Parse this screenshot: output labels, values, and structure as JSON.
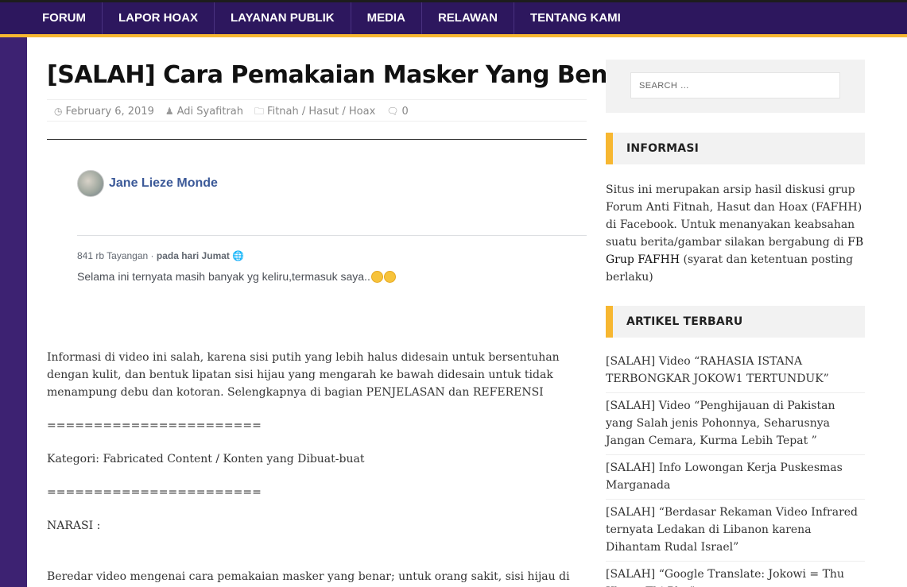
{
  "nav": [
    {
      "label": "FORUM"
    },
    {
      "label": "LAPOR HOAX"
    },
    {
      "label": "LAYANAN PUBLIK"
    },
    {
      "label": "MEDIA"
    },
    {
      "label": "RELAWAN"
    },
    {
      "label": "TENTANG KAMI"
    }
  ],
  "post": {
    "title": "[SALAH] Cara Pemakaian Masker Yang Benar",
    "date": "February 6, 2019",
    "author": "Adi Syafitrah",
    "category": "Fitnah / Hasut / Hoax",
    "comments": "0"
  },
  "embed": {
    "name": "Jane Lieze Monde",
    "views": "841 rb Tayangan",
    "separator": "·",
    "when": "pada hari Jumat",
    "caption": "Selama ini ternyata masih banyak yg keliru,termasuk saya.."
  },
  "body": {
    "para1": "Informasi di video ini salah, karena sisi putih yang lebih halus didesain untuk bersentuhan dengan kulit, dan bentuk lipatan sisi hijau yang mengarah ke bawah didesain untuk tidak menampung debu dan kotoran. Selengkapnya di bagian PENJELASAN dan REFERENSI",
    "rule1": "=======================",
    "kategori": "Kategori: Fabricated Content / Konten yang Dibuat-buat",
    "rule2": "=======================",
    "narasi": "NARASI :",
    "para2": "Beredar video mengenai cara pemakaian masker yang benar; untuk orang sakit, sisi hijau di"
  },
  "sidebar": {
    "search_placeholder": "SEARCH …",
    "informasi_title": "INFORMASI",
    "informasi_text": "Situs ini merupakan arsip hasil diskusi grup Forum Anti Fitnah, Hasut dan Hoax (FAFHH) di Facebook. Untuk menanyakan keabsahan suatu berita/gambar silakan bergabung di ",
    "informasi_link": "FB Grup FAFHH",
    "informasi_tail": " (syarat dan ketentuan posting berlaku)",
    "recent_title": "ARTIKEL TERBARU",
    "recent": [
      "[SALAH] Video “RAHASIA ISTANA TERBONGKAR JOKOW1 TERTUNDUK”",
      "[SALAH] Video “Penghijauan di Pakistan yang Salah jenis Pohonnya, Seharusnya Jangan Cemara, Kurma Lebih Tepat ”",
      "[SALAH] Info Lowongan Kerja Puskesmas Marganada",
      "[SALAH] “Berdasar Rekaman Video Infrared ternyata Ledakan di Libanon karena Dihantam Rudal Israel”",
      "[SALAH] “Google Translate: Jokowi = Thu Khang Thi Phu”"
    ]
  },
  "colors": {
    "nav_bg": "#2d175e",
    "accent": "#f7b731",
    "page_bg": "#3d2272",
    "fb_blue": "#3b5998"
  }
}
